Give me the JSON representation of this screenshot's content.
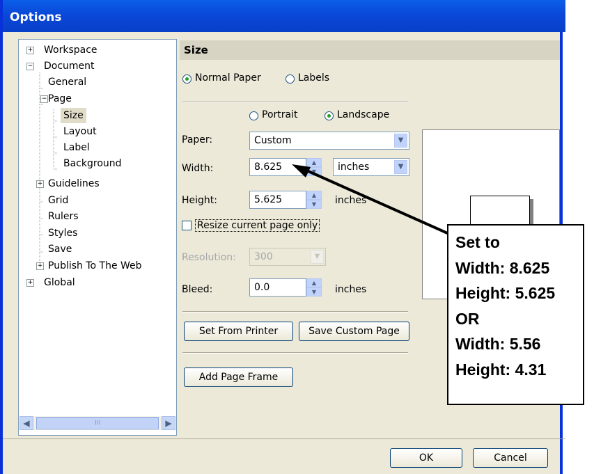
{
  "window": {
    "title": "Options"
  },
  "tree": {
    "items": [
      {
        "label": "Workspace",
        "expander": "+"
      },
      {
        "label": "Document",
        "expander": "−"
      },
      {
        "label": "General"
      },
      {
        "label": "Page",
        "expander": "−"
      },
      {
        "label": "Size",
        "selected": true
      },
      {
        "label": "Layout"
      },
      {
        "label": "Label"
      },
      {
        "label": "Background"
      },
      {
        "label": "Guidelines",
        "expander": "+"
      },
      {
        "label": "Grid"
      },
      {
        "label": "Rulers"
      },
      {
        "label": "Styles"
      },
      {
        "label": "Save"
      },
      {
        "label": "Publish To The Web",
        "expander": "+"
      },
      {
        "label": "Global",
        "expander": "+"
      }
    ],
    "scroll_left_icon": "◀",
    "scroll_right_icon": "▶",
    "scroll_thumb_grip": "III"
  },
  "panel": {
    "header": "Size",
    "mode": {
      "normal_paper": "Normal Paper",
      "labels": "Labels",
      "selected": "normal_paper"
    },
    "orientation": {
      "portrait": "Portrait",
      "landscape": "Landscape",
      "selected": "landscape"
    },
    "paper": {
      "label": "Paper:",
      "value": "Custom"
    },
    "width": {
      "label": "Width:",
      "value": "8.625"
    },
    "units": {
      "value": "inches"
    },
    "height": {
      "label": "Height:",
      "value": "5.625",
      "unit": "inches"
    },
    "resize_current_page_only": {
      "label": "Resize current page only",
      "checked": false
    },
    "resolution": {
      "label": "Resolution:",
      "value": "300",
      "disabled": true
    },
    "bleed": {
      "label": "Bleed:",
      "value": "0.0",
      "unit": "inches"
    },
    "buttons": {
      "set_from_printer": "Set From Printer",
      "save_custom_page": "Save Custom Page",
      "add_page_frame": "Add Page Frame"
    }
  },
  "footer": {
    "ok": "OK",
    "cancel": "Cancel"
  },
  "callout": {
    "lines": [
      "Set to",
      "Width: 8.625",
      "Height: 5.625",
      "OR",
      "Width: 5.56",
      "Height: 4.31"
    ]
  },
  "icons": {
    "dropdown": "▼",
    "spin_up": "▲",
    "spin_down": "▼"
  }
}
